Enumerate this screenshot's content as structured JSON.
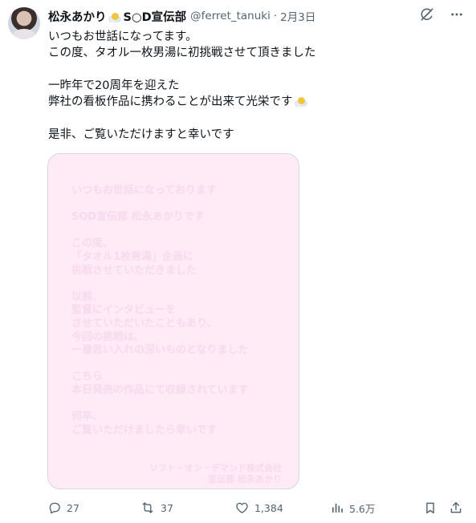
{
  "post": {
    "display_name": "松永あかり",
    "name_suffix": "S○D宣伝部",
    "handle": "@ferret_tanuki",
    "separator": "·",
    "date": "2月3日",
    "text_lines": [
      "いつもお世話になってます。",
      "この度、タオル一枚男湯に初挑戦させて頂きました",
      "",
      "一昨年で20周年を迎えた",
      "弊社の看板作品に携わることが出来て光栄です",
      "",
      "是非、ご覧いただけますと幸いです"
    ],
    "media": {
      "lines": [
        "いつもお世話になっております",
        "",
        "SOD宣伝部 松永あかりです",
        "",
        "この度、",
        "「タオル1枚男湯」企画に",
        "挑戦させていただきました",
        "",
        "以前、",
        "監督にインタビューを",
        "させていただいたこともあり、",
        "今回の挑戦は、",
        "一層思い入れの深いものとなりました",
        "",
        "こちら",
        "本日発売の作品にて収録されています",
        "",
        "何卒、",
        "ご覧いただけましたら幸いです"
      ],
      "signature": [
        "ソフト・オン・デマンド株式会社",
        "宣伝部 松永あかり"
      ]
    },
    "actions": {
      "replies": "27",
      "reposts": "37",
      "likes": "1,384",
      "views": "5.6万"
    }
  },
  "icons": {
    "grok": "grok-icon",
    "more": "more-icon",
    "reply": "reply-icon",
    "repost": "repost-icon",
    "like": "like-icon",
    "views": "views-icon",
    "bookmark": "bookmark-icon",
    "share": "share-icon"
  },
  "colors": {
    "text": "#0f1419",
    "secondary": "#536471",
    "media_bg": "#feebf6"
  }
}
